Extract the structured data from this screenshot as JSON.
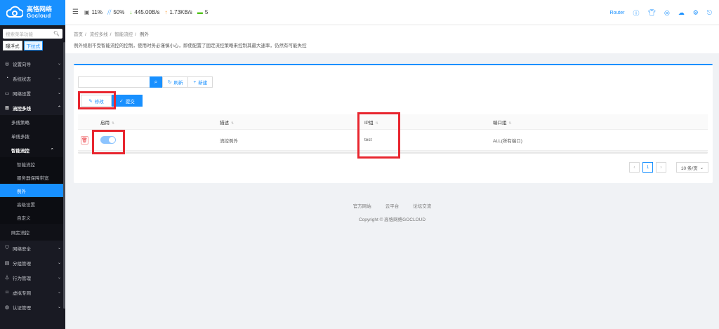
{
  "colors": {
    "accent": "#1890ff",
    "sidebar_bg": "#191a23",
    "highlight": "#e8262f"
  },
  "logo": {
    "cn": "高恪网络",
    "en": "Gocloud"
  },
  "sidebar": {
    "search_placeholder": "搜索菜单功能",
    "mode_tabs": [
      "曝浮式",
      "下拉式"
    ],
    "items_top": [
      {
        "label": "设置向导",
        "icon": "compass-icon"
      },
      {
        "label": "系统状态",
        "icon": "dashboard-icon"
      },
      {
        "label": "网络设置",
        "icon": "monitor-icon"
      }
    ],
    "open_group": {
      "label": "流控多线",
      "icon": "network-icon"
    },
    "sub_items": [
      "多线策略",
      "单线多拨"
    ],
    "open_sub": "智能流控",
    "subsub_items": [
      "智能流控",
      "服务器保障带宽",
      "例外",
      "高级设置",
      "自定义"
    ],
    "after_sub": "网定流控",
    "items_bottom": [
      {
        "label": "网络安全",
        "icon": "shield-icon"
      },
      {
        "label": "分组管理",
        "icon": "group-icon"
      },
      {
        "label": "行为管理",
        "icon": "filter-icon"
      },
      {
        "label": "虚拟专网",
        "icon": "vpn-icon"
      },
      {
        "label": "认证管理",
        "icon": "auth-icon"
      }
    ]
  },
  "header": {
    "cpu": "11%",
    "mem": "50%",
    "down": "445.00B/s",
    "up": "1.73KB/s",
    "online": "5",
    "router_label": "Router"
  },
  "breadcrumb": [
    "首页",
    "流控多线",
    "智能流控",
    "例外"
  ],
  "description": "例外规则不受智能流控的控制，使用时务必谨慎小心，即使配置了固定流控策略来控制其最大速率，仍然有可能失控",
  "toolbar": {
    "refresh": "刷新",
    "add": "新建"
  },
  "actions": {
    "edit": "修改",
    "submit": "提交"
  },
  "table": {
    "headers": {
      "enable": "启用",
      "desc": "描述",
      "ip": "IP组",
      "port": "端口组"
    },
    "rows": [
      {
        "enabled": true,
        "desc": "流控例外",
        "ip": "test",
        "port": "ALL(所有端口)"
      }
    ]
  },
  "pager": {
    "current": "1",
    "page_size": "10 条/页"
  },
  "footer": {
    "links": [
      "官方网站",
      "云平台",
      "论坛交流"
    ],
    "copyright": "Copyright © 高恪网络GOCLOUD"
  }
}
